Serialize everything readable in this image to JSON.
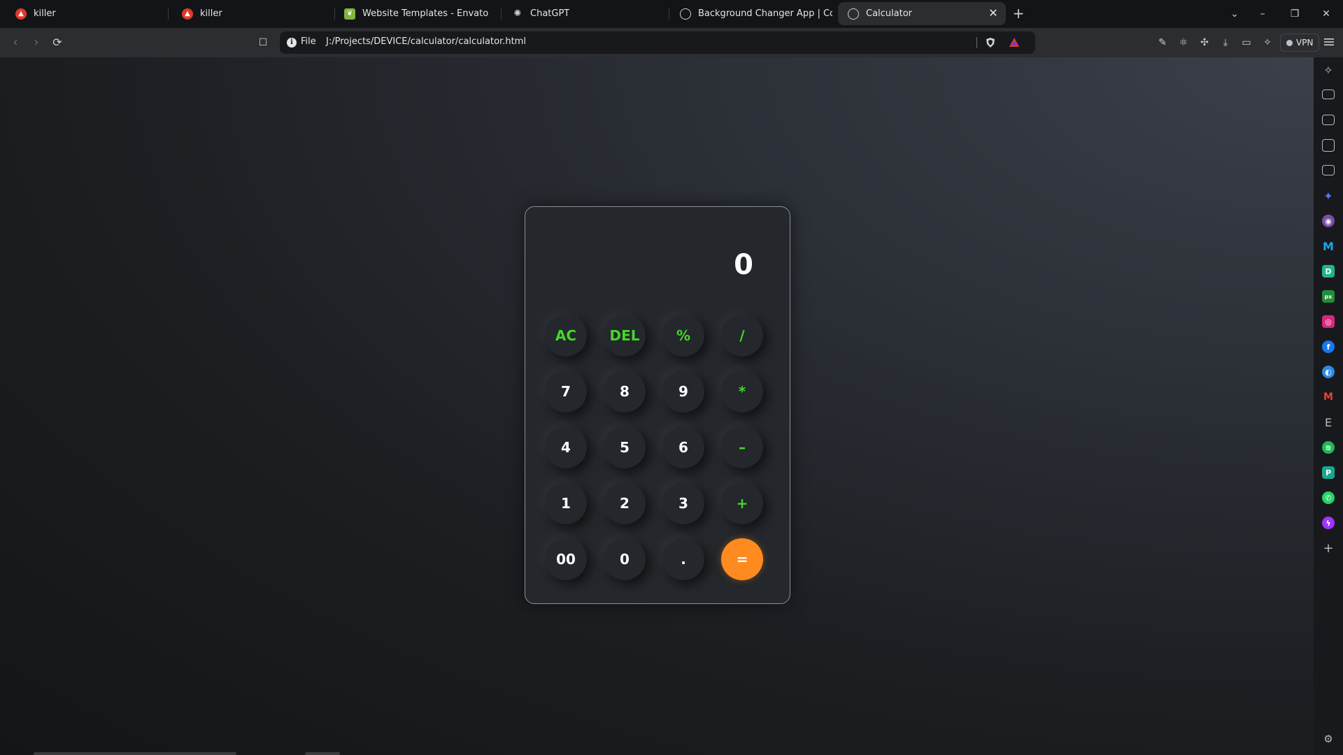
{
  "tabs": [
    {
      "label": "killer",
      "favicon": "brand-a-icon",
      "color": "#e0392b"
    },
    {
      "label": "killer",
      "favicon": "brand-a-icon",
      "color": "#e0392b"
    },
    {
      "label": "Website Templates - Envato",
      "favicon": "envato-leaf-icon",
      "color": "#81b441"
    },
    {
      "label": "ChatGPT",
      "favicon": "openai-icon",
      "color": "#d0d0d0"
    },
    {
      "label": "Background Changer App | Coding",
      "favicon": "globe-icon",
      "color": "#d0d0d0"
    },
    {
      "label": "Calculator",
      "favicon": "globe-icon",
      "color": "#d0d0d0",
      "active": true
    }
  ],
  "omnibox": {
    "scheme_chip": "File",
    "url": "J:/Projects/DEVICE/calculator/calculator.html"
  },
  "toolbar": {
    "vpn_label": "VPN"
  },
  "calculator": {
    "display": "0",
    "keys": [
      [
        "AC",
        "DEL",
        "%",
        "/"
      ],
      [
        "7",
        "8",
        "9",
        "*"
      ],
      [
        "4",
        "5",
        "6",
        "–"
      ],
      [
        "1",
        "2",
        "3",
        "+"
      ],
      [
        "00",
        "0",
        ".",
        "="
      ]
    ],
    "colors": {
      "operator": "#44d62c",
      "equals": "#ff8a1f",
      "digit": "#ffffff"
    }
  },
  "sidebar_icons": [
    "leo-ai-icon",
    "video-icon",
    "wallet-icon",
    "bookmark-icon",
    "reading-list-icon",
    "star-sparkle-icon",
    "tor-icon",
    "malwarebytes-icon",
    "dribbble-icon",
    "pixabay-icon",
    "instagram-icon",
    "facebook-icon",
    "browser-icon",
    "gmail-icon",
    "envato-e-icon",
    "spotify-icon",
    "pinterest-icon",
    "whatsapp-icon",
    "messenger-icon",
    "add-icon"
  ]
}
